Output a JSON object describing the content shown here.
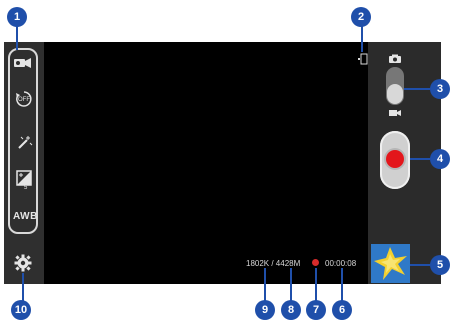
{
  "status_bar": {
    "storage": "1802K / 4428M",
    "timer": "00:00:08",
    "recording_indicator_color": "#d62b2b"
  },
  "left_menu": {
    "shooting_mode_icon": "camcorder-mode-icon",
    "timer_icon": "timer-off-icon",
    "timer_label": "OFF",
    "effects_icon": "magic-wand-icon",
    "exposure_icon": "exposure-icon",
    "exposure_value": "5",
    "white_balance_label": "AWB",
    "settings_icon": "gear-icon"
  },
  "right_panel": {
    "camera_icon": "camera-icon",
    "video_icon": "video-icon",
    "record_button_color": "#e3161b"
  },
  "callouts": [
    "1",
    "2",
    "3",
    "4",
    "5",
    "6",
    "7",
    "8",
    "9",
    "10"
  ]
}
